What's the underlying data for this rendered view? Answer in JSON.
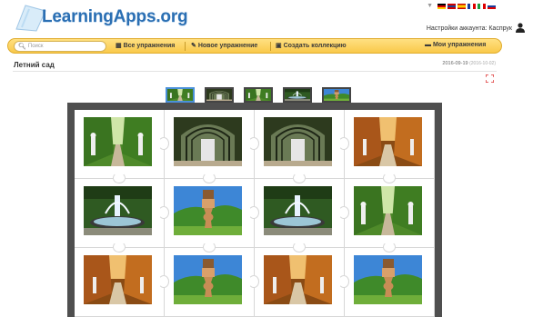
{
  "header": {
    "logo_text": "LearningApps.org",
    "account_label": "Настройки аккаунта: Каспрук",
    "languages": [
      "de",
      "gb",
      "es",
      "fr",
      "it",
      "ru"
    ]
  },
  "nav": {
    "search_placeholder": "Поиск",
    "items": [
      {
        "label": "Все упражнения",
        "icon": "grid-icon"
      },
      {
        "label": "Новое упражнение",
        "icon": "pencil-icon"
      },
      {
        "label": "Создать коллекцию",
        "icon": "collection-icon"
      },
      {
        "label": "Мои упражнения",
        "icon": "folder-icon"
      }
    ]
  },
  "page": {
    "title": "Летний сад",
    "date": "2016-09-19",
    "date_small": "(2016-10-02)"
  },
  "exercise": {
    "category_tabs": [
      "Статуи",
      "Ворота",
      "Аллея",
      "Фонтан",
      "Ваза"
    ],
    "active_tab": 0,
    "cards": [
      "statues-alley",
      "gate-arch",
      "gate-arch",
      "autumn-alley",
      "fountain",
      "vase",
      "fountain",
      "statues-alley",
      "autumn-alley",
      "vase",
      "autumn-alley",
      "vase"
    ]
  },
  "colors": {
    "brand_blue": "#2b6fb3",
    "nav_yellow": "#f9c94a",
    "board_gray": "#4f4f4f",
    "active_tab_blue": "#4a90d9"
  }
}
